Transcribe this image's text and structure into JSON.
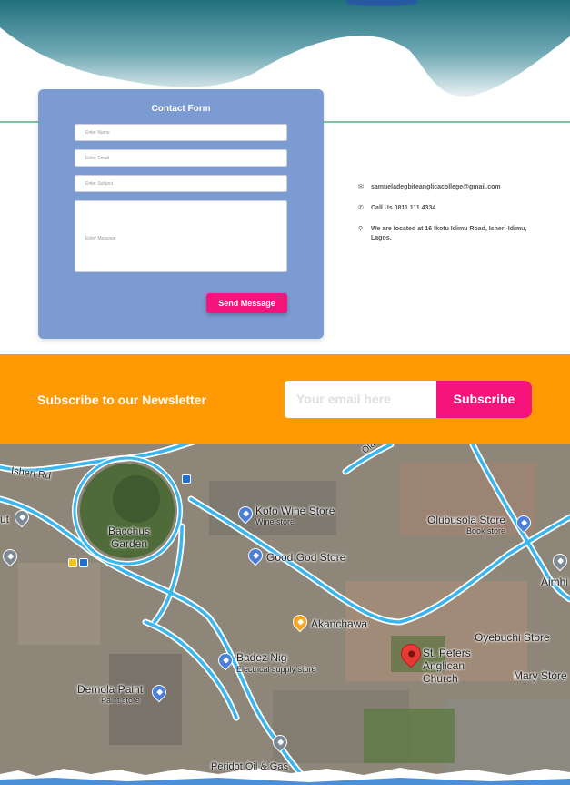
{
  "contact_form": {
    "title": "Contact Form",
    "name_placeholder": "Enter Name",
    "email_placeholder": "Enter Email",
    "subject_placeholder": "Enter Subject",
    "message_placeholder": "Enter Message",
    "send_label": "Send Message",
    "card_color": "#7b9bd2",
    "button_color": "#f4147c"
  },
  "contact_info": {
    "email": "samueladegbiteanglicacollege@gmail.com",
    "phone": "Call Us 0811 111 4334",
    "address": "We are located at 16 Ikotu Idimu Road, Isheri-Idimu, Lagos.",
    "email_icon": "envelope-icon",
    "phone_icon": "phone-icon",
    "address_icon": "location-pin-icon"
  },
  "newsletter": {
    "title": "Subscribe to our Newsletter",
    "input_placeholder": "Your email here",
    "button_label": "Subscribe",
    "band_color": "#ff9a05"
  },
  "map": {
    "labels": {
      "road_isheri": "Isheri Rd",
      "bacchus_garden": "Bacchus Garden",
      "kofo": "Kofo Wine Store",
      "kofo_sub": "Wine store",
      "olubusola": "Olubusola Store",
      "olubusola_sub": "Book store",
      "good_god": "Good God Store",
      "aimhi": "Aimhi",
      "akanchawa": "Akanchawa",
      "oyebuchi": "Oyebuchi Store",
      "st_peters": "St. Peters Anglican Church",
      "mary": "Mary Store",
      "badez": "Badez Nig",
      "badez_sub": "Electrical supply store",
      "demola": "Demola Paint",
      "demola_sub": "Paint store",
      "peridot": "Peridot Oil & Gas",
      "out_partial": "ut",
      "road_top": "Ola"
    }
  }
}
